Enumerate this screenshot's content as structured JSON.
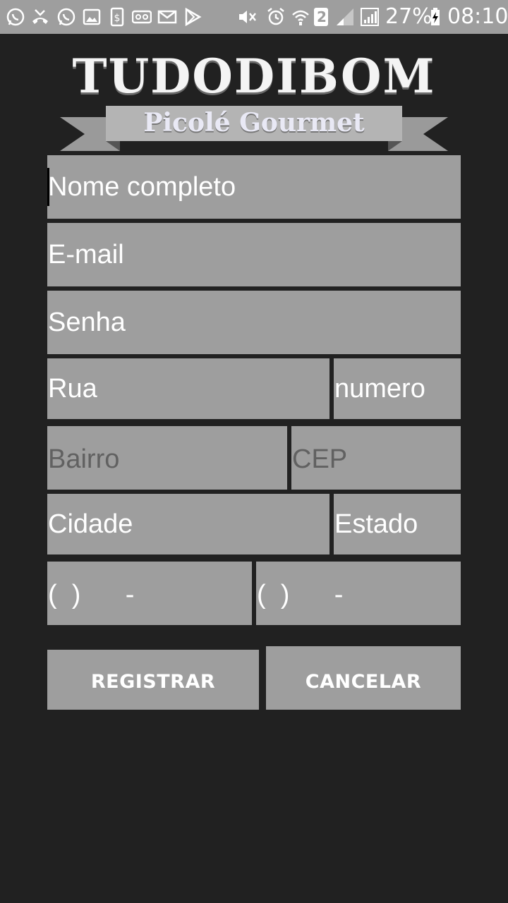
{
  "status_bar": {
    "battery_percent": "27%",
    "time": "08:10",
    "sim_slot": "2",
    "left_icons": [
      "whatsapp-icon",
      "missed-call-icon",
      "whatsapp-icon",
      "image-icon",
      "money-icon",
      "voicemail-icon",
      "mail-icon",
      "play-store-icon"
    ],
    "right_icons": [
      "mute-icon",
      "alarm-icon",
      "wifi-icon",
      "sim-icon",
      "signal-icon",
      "signal-icon",
      "battery-charging-icon"
    ]
  },
  "logo": {
    "title": "TUDODIBOM",
    "subtitle": "Picolé Gourmet"
  },
  "form": {
    "nome": {
      "value": "Nome completo"
    },
    "email": {
      "value": "E-mail"
    },
    "senha": {
      "value": "Senha"
    },
    "rua": {
      "value": "Rua"
    },
    "numero": {
      "value": "numero"
    },
    "bairro": {
      "placeholder": "Bairro"
    },
    "cep": {
      "placeholder": "CEP"
    },
    "cidade": {
      "value": "Cidade"
    },
    "estado": {
      "value": "Estado"
    },
    "telefone1": {
      "value": "(  )      -"
    },
    "telefone2": {
      "value": "(  )      -"
    }
  },
  "buttons": {
    "registrar": "REGISTRAR",
    "cancelar": "CANCELAR"
  },
  "colors": {
    "background": "#212121",
    "field": "#9e9e9e",
    "status_bar": "#9e9e9e",
    "hint_text": "#616161",
    "text": "#ffffff"
  }
}
